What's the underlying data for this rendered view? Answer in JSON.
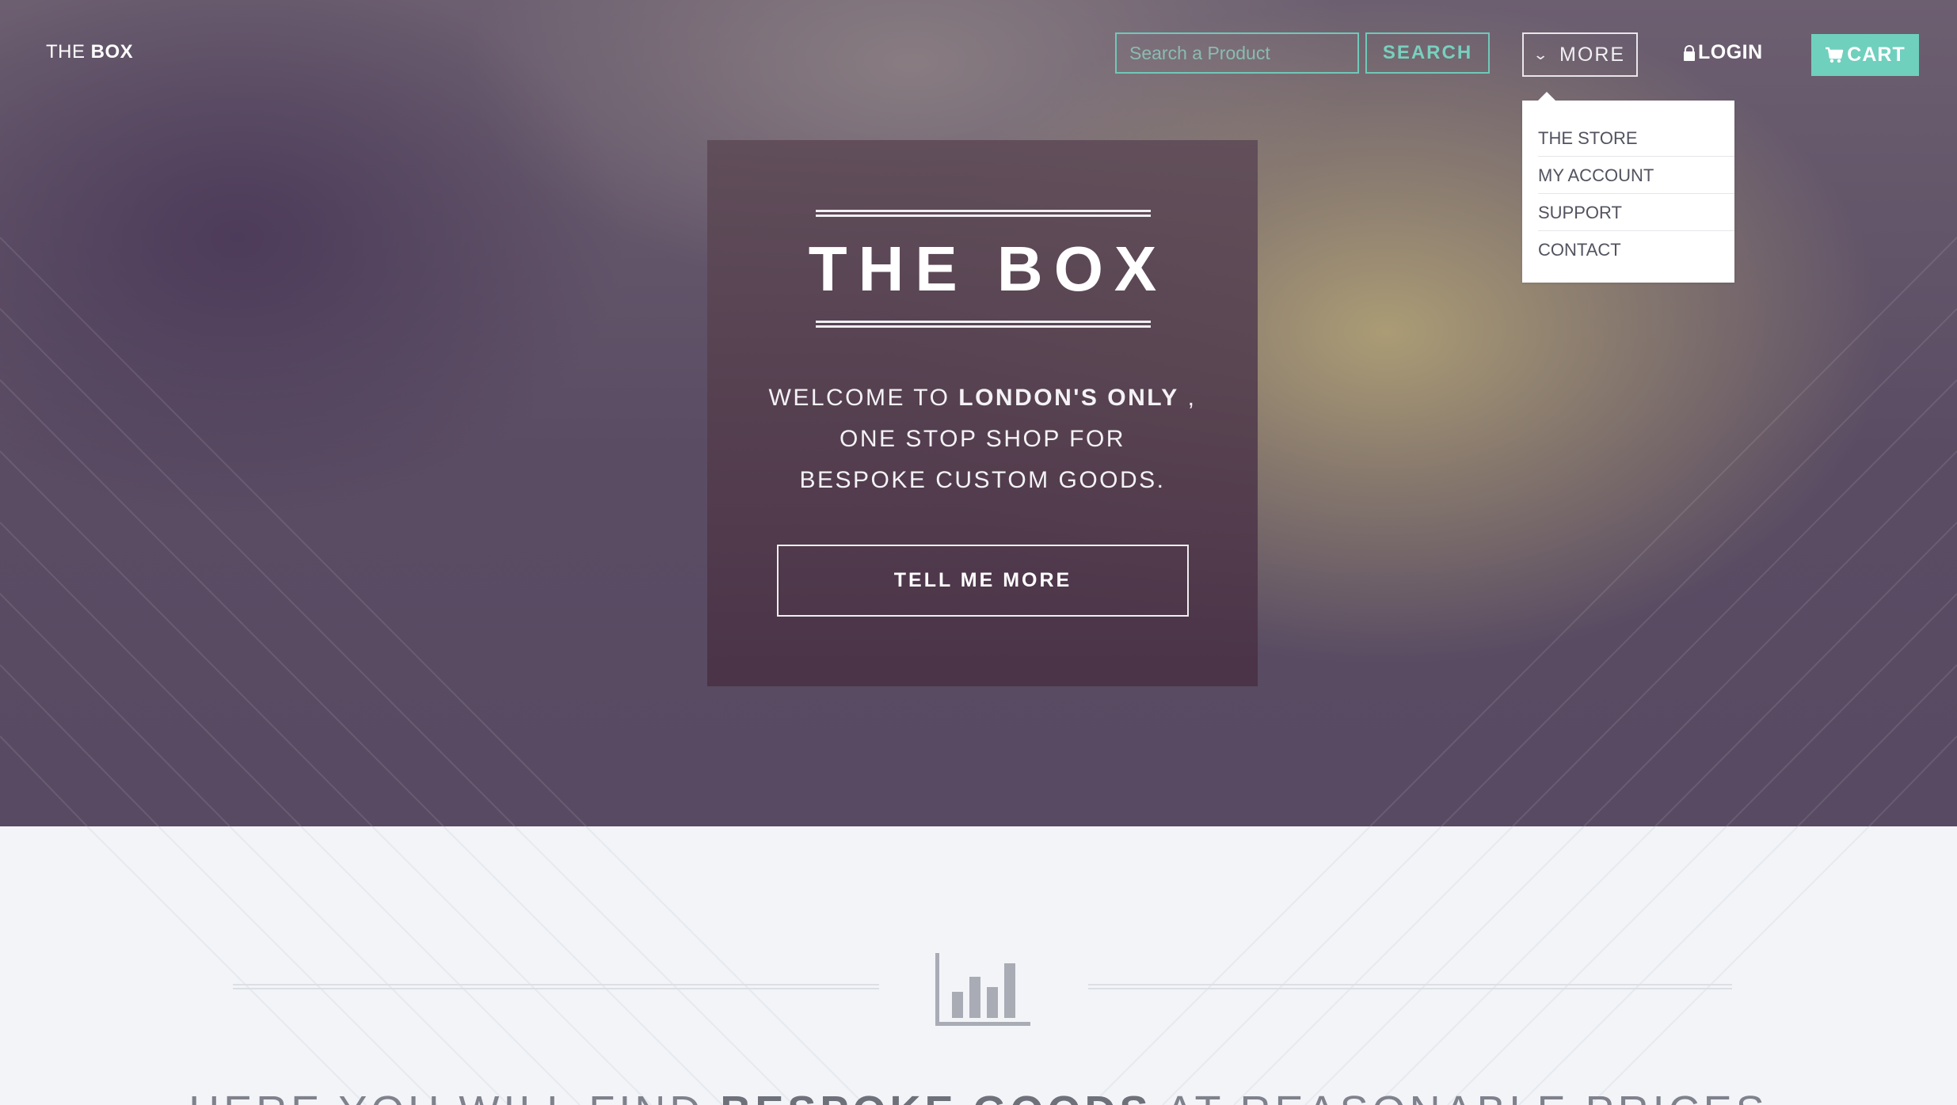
{
  "brand": {
    "light": "THE ",
    "bold": "BOX"
  },
  "nav": {
    "search_placeholder": "Search a Product",
    "search_label": "SEARCH",
    "more_label": "MORE",
    "more_icon": "chevron-down-icon",
    "login_label": "LOGIN",
    "login_icon": "lock-icon",
    "cart_label": "CART",
    "cart_icon": "cart-icon"
  },
  "dropdown": {
    "items": [
      {
        "label": "THE STORE"
      },
      {
        "label": "MY ACCOUNT"
      },
      {
        "label": "SUPPORT"
      },
      {
        "label": "CONTACT"
      }
    ]
  },
  "hero": {
    "title": "THE BOX",
    "welcome_prefix": "WELCOME TO ",
    "welcome_bold": "LONDON'S ONLY",
    "welcome_suffix": " ,",
    "line2": "ONE STOP SHOP FOR",
    "line3": "BESPOKE CUSTOM GOODS.",
    "button_label": "TELL ME MORE"
  },
  "section": {
    "icon": "bar-chart-icon",
    "tagline_prefix": "HERE YOU WILL FIND ",
    "tagline_bold": "BESPOKE GOODS",
    "tagline_suffix": " AT REASONABLE PRICES"
  },
  "colors": {
    "accent": "#6fd0bd",
    "dropdown_text": "#52535f",
    "lower_bg": "#f2f4f8"
  }
}
